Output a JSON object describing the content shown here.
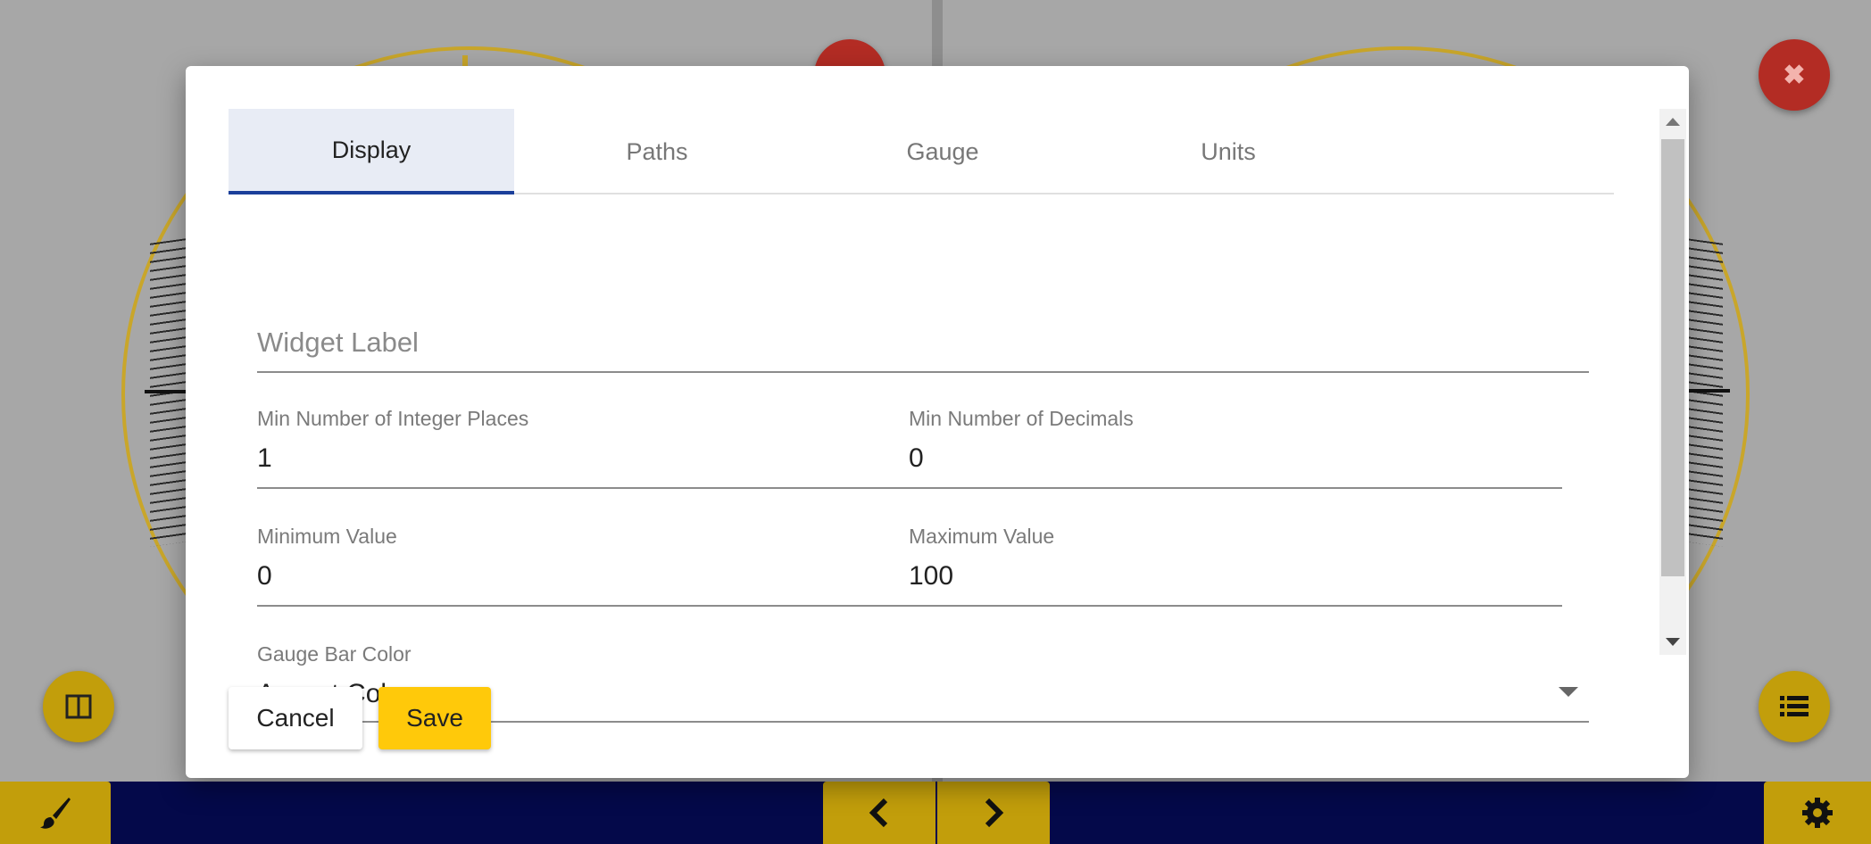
{
  "dialog": {
    "tabs": [
      {
        "label": "Display",
        "active": true
      },
      {
        "label": "Paths",
        "active": false
      },
      {
        "label": "Gauge",
        "active": false
      },
      {
        "label": "Units",
        "active": false
      }
    ],
    "widget_label": {
      "placeholder": "Widget Label",
      "value": ""
    },
    "min_integer_places": {
      "label": "Min Number of Integer Places",
      "value": "1"
    },
    "min_decimals": {
      "label": "Min Number of Decimals",
      "value": "0"
    },
    "minimum_value": {
      "label": "Minimum Value",
      "value": "0"
    },
    "maximum_value": {
      "label": "Maximum Value",
      "value": "100"
    },
    "gauge_bar_color": {
      "label": "Gauge Bar Color",
      "value": "Accent Color"
    },
    "buttons": {
      "cancel": "Cancel",
      "save": "Save"
    }
  },
  "icons": {
    "close": "close-icon",
    "layout": "columns-icon",
    "list": "list-icon",
    "paint": "paintbrush-icon",
    "prev": "chevron-left-icon",
    "next": "chevron-right-icon",
    "settings": "gear-icon"
  },
  "colors": {
    "accent": "#ffc90a",
    "fab_gold": "#c29e0b",
    "close_red": "#b32c24",
    "bottom_bar": "#04094a",
    "tab_indicator": "#1b3f9a"
  }
}
